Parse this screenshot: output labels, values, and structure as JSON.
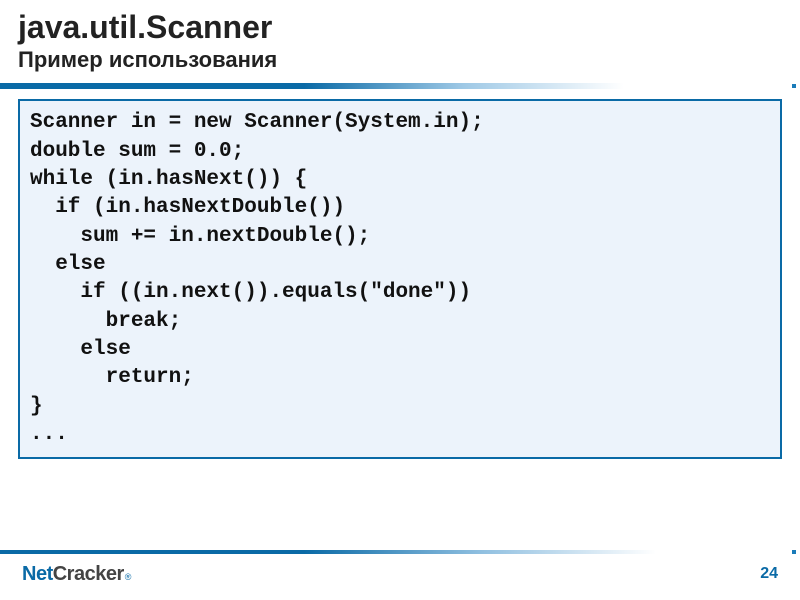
{
  "title": "java.util.Scanner",
  "subtitle": "Пример использования",
  "code": "Scanner in = new Scanner(System.in);\ndouble sum = 0.0;\nwhile (in.hasNext()) {\n  if (in.hasNextDouble())\n    sum += in.nextDouble();\n  else\n    if ((in.next()).equals(\"done\"))\n      break;\n    else\n      return;\n}\n...",
  "footer": {
    "logo_net": "Net",
    "logo_cracker": "Cracker",
    "logo_reg": "®",
    "page_number": "24"
  }
}
